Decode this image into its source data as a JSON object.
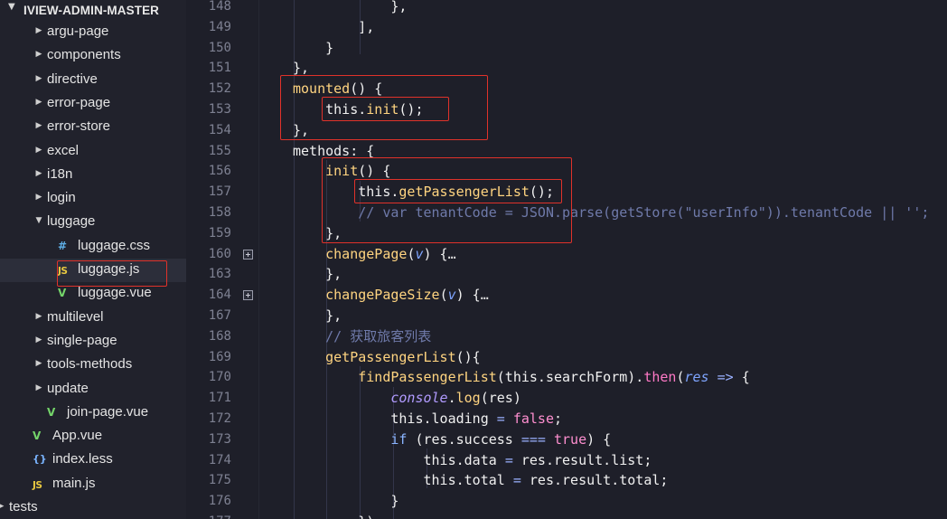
{
  "explorer": {
    "title": "IVIEW-ADMIN-MASTER",
    "items": [
      {
        "label": "argu-page",
        "type": "folder",
        "expanded": false
      },
      {
        "label": "components",
        "type": "folder",
        "expanded": false
      },
      {
        "label": "directive",
        "type": "folder",
        "expanded": false
      },
      {
        "label": "error-page",
        "type": "folder",
        "expanded": false
      },
      {
        "label": "error-store",
        "type": "folder",
        "expanded": false
      },
      {
        "label": "excel",
        "type": "folder",
        "expanded": false
      },
      {
        "label": "i18n",
        "type": "folder",
        "expanded": false
      },
      {
        "label": "login",
        "type": "folder",
        "expanded": false
      },
      {
        "label": "luggage",
        "type": "folder",
        "expanded": true
      },
      {
        "label": "luggage.css",
        "type": "css"
      },
      {
        "label": "luggage.js",
        "type": "js",
        "selected": true
      },
      {
        "label": "luggage.vue",
        "type": "vue"
      },
      {
        "label": "multilevel",
        "type": "folder",
        "expanded": false
      },
      {
        "label": "single-page",
        "type": "folder",
        "expanded": false
      },
      {
        "label": "tools-methods",
        "type": "folder",
        "expanded": false
      },
      {
        "label": "update",
        "type": "folder",
        "expanded": false
      },
      {
        "label": "join-page.vue",
        "type": "vue"
      },
      {
        "label": "App.vue",
        "type": "vue"
      },
      {
        "label": "index.less",
        "type": "less"
      },
      {
        "label": "main.js",
        "type": "js"
      },
      {
        "label": "tests",
        "type": "folder",
        "expanded": false
      }
    ]
  },
  "icons": {
    "folder_collapsed": "chevron-right-icon",
    "folder_expanded": "chevron-down-icon",
    "css": "#",
    "js": "JS",
    "vue": "V",
    "less": "{}"
  },
  "colors": {
    "annotation": "#e0322a",
    "keyword": "#ff79c6",
    "function": "#ffd480",
    "comment": "#6f7aaa"
  },
  "editor": {
    "lines": [
      {
        "n": "148",
        "tokens": [
          [
            "t-punc",
            "            },"
          ]
        ]
      },
      {
        "n": "149",
        "tokens": [
          [
            "t-punc",
            "        ],"
          ]
        ]
      },
      {
        "n": "150",
        "tokens": [
          [
            "t-punc",
            "    }"
          ]
        ]
      },
      {
        "n": "151",
        "tokens": [
          [
            "t-punc",
            "},"
          ]
        ]
      },
      {
        "n": "152",
        "tokens": [
          [
            "t-key",
            "mounted"
          ],
          [
            "t-punc",
            "() {"
          ]
        ]
      },
      {
        "n": "153",
        "tokens": [
          [
            "t-plain",
            "    this."
          ],
          [
            "t-fn",
            "init"
          ],
          [
            "t-punc",
            "();"
          ]
        ]
      },
      {
        "n": "154",
        "tokens": [
          [
            "t-punc",
            "},"
          ]
        ]
      },
      {
        "n": "155",
        "tokens": [
          [
            "t-plain",
            "methods"
          ],
          [
            "t-punc",
            ": {"
          ]
        ]
      },
      {
        "n": "156",
        "tokens": [
          [
            "t-fn",
            "    init"
          ],
          [
            "t-punc",
            "() {"
          ]
        ]
      },
      {
        "n": "157",
        "tokens": [
          [
            "t-plain",
            "        this."
          ],
          [
            "t-fn",
            "getPassengerList"
          ],
          [
            "t-punc",
            "();"
          ]
        ]
      },
      {
        "n": "158",
        "tokens": [
          [
            "t-comment",
            "        // var tenantCode = JSON.parse(getStore(\"userInfo\")).tenantCode || '';"
          ]
        ]
      },
      {
        "n": "159",
        "tokens": [
          [
            "t-punc",
            "    },"
          ]
        ]
      },
      {
        "n": "160",
        "fold": true,
        "tokens": [
          [
            "t-fn",
            "    changePage"
          ],
          [
            "t-punc",
            "("
          ],
          [
            "t-param",
            "v"
          ],
          [
            "t-punc",
            ") {"
          ],
          [
            "t-ell",
            "…"
          ]
        ]
      },
      {
        "n": "163",
        "tokens": [
          [
            "t-punc",
            "    },"
          ]
        ]
      },
      {
        "n": "164",
        "fold": true,
        "tokens": [
          [
            "t-fn",
            "    changePageSize"
          ],
          [
            "t-punc",
            "("
          ],
          [
            "t-param",
            "v"
          ],
          [
            "t-punc",
            ") {"
          ],
          [
            "t-ell",
            "…"
          ]
        ]
      },
      {
        "n": "167",
        "tokens": [
          [
            "t-punc",
            "    },"
          ]
        ]
      },
      {
        "n": "168",
        "tokens": [
          [
            "t-comment",
            "    // 获取旅客列表"
          ]
        ]
      },
      {
        "n": "169",
        "tokens": [
          [
            "t-fn",
            "    getPassengerList"
          ],
          [
            "t-punc",
            "(){"
          ]
        ]
      },
      {
        "n": "170",
        "tokens": [
          [
            "t-fn",
            "        findPassengerList"
          ],
          [
            "t-punc",
            "(this.searchForm)."
          ],
          [
            "t-kw",
            "then"
          ],
          [
            "t-punc",
            "("
          ],
          [
            "t-param",
            "res"
          ],
          [
            "t-op",
            " => "
          ],
          [
            "t-punc",
            "{"
          ]
        ]
      },
      {
        "n": "171",
        "tokens": [
          [
            "t-console",
            "            console"
          ],
          [
            "t-punc",
            "."
          ],
          [
            "t-fn",
            "log"
          ],
          [
            "t-punc",
            "(res)"
          ]
        ]
      },
      {
        "n": "172",
        "tokens": [
          [
            "t-plain",
            "            this.loading "
          ],
          [
            "t-op",
            "="
          ],
          [
            "t-bool",
            " false"
          ],
          [
            "t-punc",
            ";"
          ]
        ]
      },
      {
        "n": "173",
        "tokens": [
          [
            "t-kwb",
            "            if"
          ],
          [
            "t-punc",
            " (res.success "
          ],
          [
            "t-op",
            "==="
          ],
          [
            "t-bool",
            " true"
          ],
          [
            "t-punc",
            ") {"
          ]
        ]
      },
      {
        "n": "174",
        "tokens": [
          [
            "t-plain",
            "                this.data "
          ],
          [
            "t-op",
            "="
          ],
          [
            "t-plain",
            " res.result.list;"
          ]
        ]
      },
      {
        "n": "175",
        "tokens": [
          [
            "t-plain",
            "                this.total "
          ],
          [
            "t-op",
            "="
          ],
          [
            "t-plain",
            " res.result.total;"
          ]
        ]
      },
      {
        "n": "176",
        "tokens": [
          [
            "t-punc",
            "            }"
          ]
        ]
      },
      {
        "n": "177",
        "tokens": [
          [
            "t-punc",
            "        })"
          ]
        ]
      }
    ]
  }
}
